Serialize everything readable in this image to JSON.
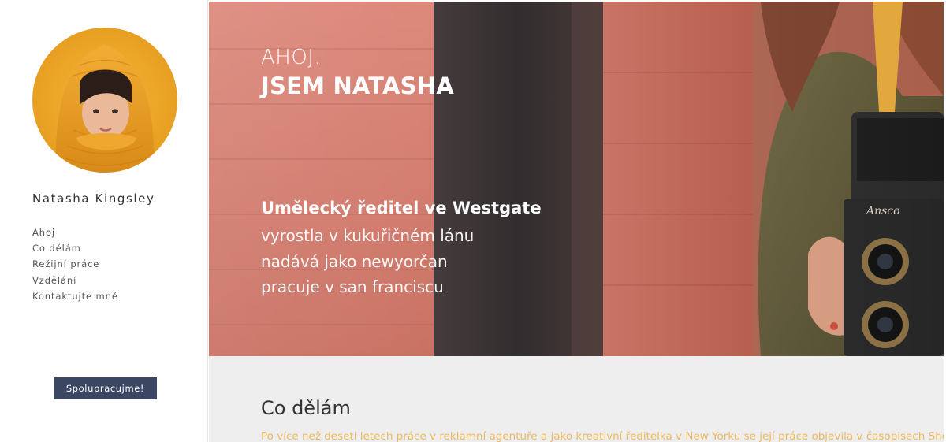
{
  "sidebar": {
    "name": "Natasha Kingsley",
    "nav": [
      {
        "label": "Ahoj"
      },
      {
        "label": "Co dělám"
      },
      {
        "label": "Režijní práce"
      },
      {
        "label": "Vzdělání"
      },
      {
        "label": "Kontaktujte mně"
      }
    ],
    "cta_label": "Spolupracujme!"
  },
  "hero": {
    "greeting": "AHOJ.",
    "title": "JSEM NATASHA",
    "role": "Umělecký ředitel ve Westgate",
    "lines": [
      "vyrostla v kukuřičném lánu",
      "nadává jako newyorčan",
      "pracuje v san franciscu"
    ],
    "camera_brand": "Ansco"
  },
  "section": {
    "title": "Co dělám",
    "text": "Po více než deseti letech práce v reklamní agentuře a jako kreativní ředitelka v New Yorku se její práce objevila v časopisech Shots"
  },
  "colors": {
    "accent_button": "#3b4662",
    "section_text": "#efb95d",
    "section_bg": "#eeeeee"
  }
}
